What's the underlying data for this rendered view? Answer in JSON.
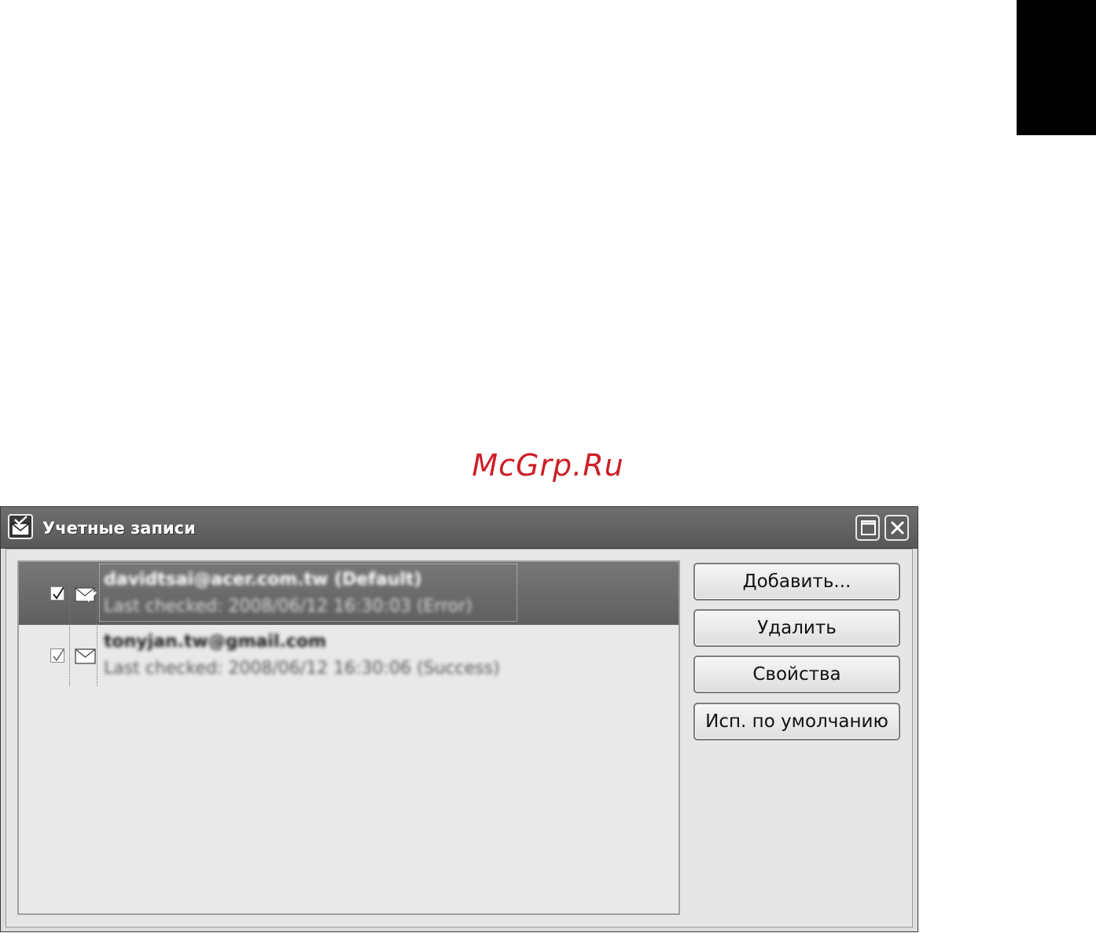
{
  "watermark": "McGrp.Ru",
  "window": {
    "title": "Учетные записи",
    "icons": {
      "app": "mail-window-icon",
      "maximize": "maximize-icon",
      "close": "close-icon"
    }
  },
  "accounts": [
    {
      "name": "davidtsai@acer.com.tw (Default)",
      "status": "Last checked: 2008/06/12 16:30:03 (Error)",
      "enabled": true,
      "selected": true,
      "icon": "envelope-check-icon"
    },
    {
      "name": "tonyjan.tw@gmail.com",
      "status": "Last checked: 2008/06/12 16:30:06 (Success)",
      "enabled": true,
      "selected": false,
      "icon": "envelope-icon"
    }
  ],
  "buttons": {
    "add": "Добавить...",
    "delete": "Удалить",
    "properties": "Свойства",
    "set_default": "Исп. по умолчанию"
  },
  "colors": {
    "watermark": "#cc1f26",
    "selection": "#666666",
    "titlebar": "#626262"
  }
}
